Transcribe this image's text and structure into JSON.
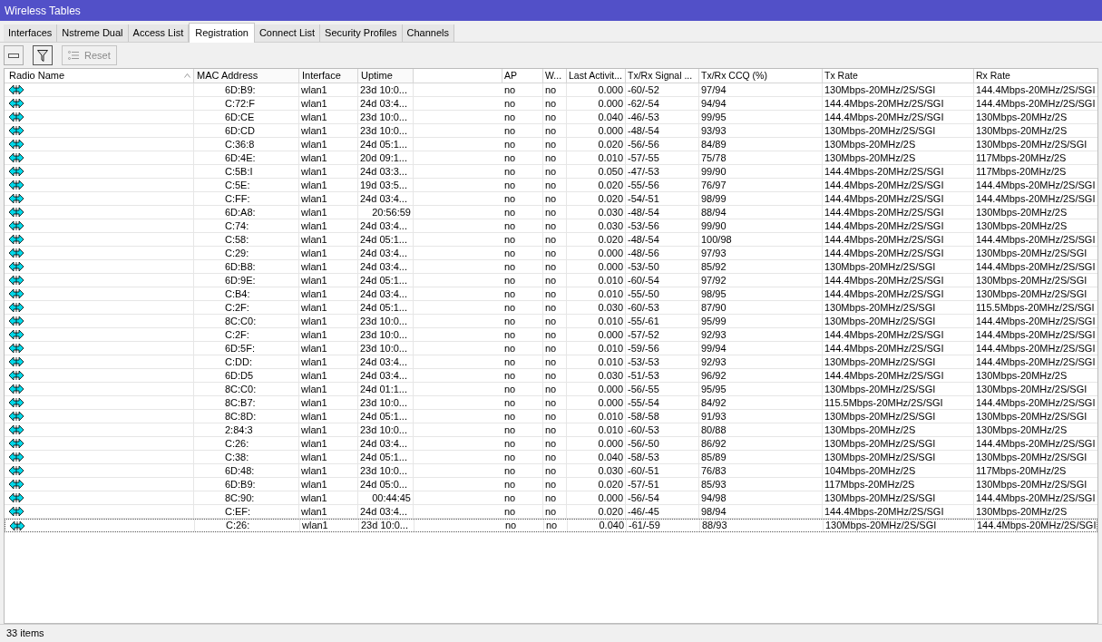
{
  "window": {
    "title": "Wireless Tables"
  },
  "tabs": [
    {
      "label": "Interfaces",
      "selected": false
    },
    {
      "label": "Nstreme Dual",
      "selected": false
    },
    {
      "label": "Access List",
      "selected": false
    },
    {
      "label": "Registration",
      "selected": true
    },
    {
      "label": "Connect List",
      "selected": false
    },
    {
      "label": "Security Profiles",
      "selected": false
    },
    {
      "label": "Channels",
      "selected": false
    }
  ],
  "toolbar": {
    "reset": {
      "label": "Reset",
      "disabled": true
    }
  },
  "table": {
    "columns": [
      {
        "label": "Radio Name",
        "sorted": true
      },
      {
        "label": "MAC Address",
        "sorted": false
      },
      {
        "label": "Interface",
        "sorted": false
      },
      {
        "label": "Uptime",
        "sorted": false
      },
      {
        "label": "AP",
        "sorted": false
      },
      {
        "label": "W...",
        "sorted": false
      },
      {
        "label": "Last Activit...",
        "sorted": false
      },
      {
        "label": "Tx/Rx Signal ...",
        "sorted": false
      },
      {
        "label": "Tx/Rx CCQ (%)",
        "sorted": false
      },
      {
        "label": "Tx Rate",
        "sorted": false
      },
      {
        "label": "Rx Rate",
        "sorted": false
      }
    ],
    "rows": [
      {
        "mac": "6D:B9:",
        "interface": "wlan1",
        "uptime": "23d 10:0...",
        "ap": "no",
        "w": "no",
        "last_activity": "0.000",
        "signal": "-60/-52",
        "ccq": "97/94",
        "tx_rate": "130Mbps-20MHz/2S/SGI",
        "rx_rate": "144.4Mbps-20MHz/2S/SGI",
        "focused": false
      },
      {
        "mac": "C:72:F",
        "interface": "wlan1",
        "uptime": "24d 03:4...",
        "ap": "no",
        "w": "no",
        "last_activity": "0.000",
        "signal": "-62/-54",
        "ccq": "94/94",
        "tx_rate": "144.4Mbps-20MHz/2S/SGI",
        "rx_rate": "144.4Mbps-20MHz/2S/SGI",
        "focused": false
      },
      {
        "mac": "6D:CE",
        "interface": "wlan1",
        "uptime": "23d 10:0...",
        "ap": "no",
        "w": "no",
        "last_activity": "0.040",
        "signal": "-46/-53",
        "ccq": "99/95",
        "tx_rate": "144.4Mbps-20MHz/2S/SGI",
        "rx_rate": "130Mbps-20MHz/2S",
        "focused": false
      },
      {
        "mac": "6D:CD",
        "interface": "wlan1",
        "uptime": "23d 10:0...",
        "ap": "no",
        "w": "no",
        "last_activity": "0.000",
        "signal": "-48/-54",
        "ccq": "93/93",
        "tx_rate": "130Mbps-20MHz/2S/SGI",
        "rx_rate": "130Mbps-20MHz/2S",
        "focused": false
      },
      {
        "mac": "C:36:8",
        "interface": "wlan1",
        "uptime": "24d 05:1...",
        "ap": "no",
        "w": "no",
        "last_activity": "0.020",
        "signal": "-56/-56",
        "ccq": "84/89",
        "tx_rate": "130Mbps-20MHz/2S",
        "rx_rate": "130Mbps-20MHz/2S/SGI",
        "focused": false
      },
      {
        "mac": "6D:4E:",
        "interface": "wlan1",
        "uptime": "20d 09:1...",
        "ap": "no",
        "w": "no",
        "last_activity": "0.010",
        "signal": "-57/-55",
        "ccq": "75/78",
        "tx_rate": "130Mbps-20MHz/2S",
        "rx_rate": "117Mbps-20MHz/2S",
        "focused": false
      },
      {
        "mac": "C:5B:I",
        "interface": "wlan1",
        "uptime": "24d 03:3...",
        "ap": "no",
        "w": "no",
        "last_activity": "0.050",
        "signal": "-47/-53",
        "ccq": "99/90",
        "tx_rate": "144.4Mbps-20MHz/2S/SGI",
        "rx_rate": "117Mbps-20MHz/2S",
        "focused": false
      },
      {
        "mac": "C:5E:",
        "interface": "wlan1",
        "uptime": "19d 03:5...",
        "ap": "no",
        "w": "no",
        "last_activity": "0.020",
        "signal": "-55/-56",
        "ccq": "76/97",
        "tx_rate": "144.4Mbps-20MHz/2S/SGI",
        "rx_rate": "144.4Mbps-20MHz/2S/SGI",
        "focused": false
      },
      {
        "mac": "C:FF:",
        "interface": "wlan1",
        "uptime": "24d 03:4...",
        "ap": "no",
        "w": "no",
        "last_activity": "0.020",
        "signal": "-54/-51",
        "ccq": "98/99",
        "tx_rate": "144.4Mbps-20MHz/2S/SGI",
        "rx_rate": "144.4Mbps-20MHz/2S/SGI",
        "focused": false
      },
      {
        "mac": "6D:A8:",
        "interface": "wlan1",
        "uptime": "20:56:59",
        "ap": "no",
        "w": "no",
        "last_activity": "0.030",
        "signal": "-48/-54",
        "ccq": "88/94",
        "tx_rate": "144.4Mbps-20MHz/2S/SGI",
        "rx_rate": "130Mbps-20MHz/2S",
        "focused": false
      },
      {
        "mac": "C:74:",
        "interface": "wlan1",
        "uptime": "24d 03:4...",
        "ap": "no",
        "w": "no",
        "last_activity": "0.030",
        "signal": "-53/-56",
        "ccq": "99/90",
        "tx_rate": "144.4Mbps-20MHz/2S/SGI",
        "rx_rate": "130Mbps-20MHz/2S",
        "focused": false
      },
      {
        "mac": "C:58:",
        "interface": "wlan1",
        "uptime": "24d 05:1...",
        "ap": "no",
        "w": "no",
        "last_activity": "0.020",
        "signal": "-48/-54",
        "ccq": "100/98",
        "tx_rate": "144.4Mbps-20MHz/2S/SGI",
        "rx_rate": "144.4Mbps-20MHz/2S/SGI",
        "focused": false
      },
      {
        "mac": "C:29:",
        "interface": "wlan1",
        "uptime": "24d 03:4...",
        "ap": "no",
        "w": "no",
        "last_activity": "0.000",
        "signal": "-48/-56",
        "ccq": "97/93",
        "tx_rate": "144.4Mbps-20MHz/2S/SGI",
        "rx_rate": "130Mbps-20MHz/2S/SGI",
        "focused": false
      },
      {
        "mac": "6D:B8:",
        "interface": "wlan1",
        "uptime": "24d 03:4...",
        "ap": "no",
        "w": "no",
        "last_activity": "0.000",
        "signal": "-53/-50",
        "ccq": "85/92",
        "tx_rate": "130Mbps-20MHz/2S/SGI",
        "rx_rate": "144.4Mbps-20MHz/2S/SGI",
        "focused": false
      },
      {
        "mac": "6D:9E:",
        "interface": "wlan1",
        "uptime": "24d 05:1...",
        "ap": "no",
        "w": "no",
        "last_activity": "0.010",
        "signal": "-60/-54",
        "ccq": "97/92",
        "tx_rate": "144.4Mbps-20MHz/2S/SGI",
        "rx_rate": "130Mbps-20MHz/2S/SGI",
        "focused": false
      },
      {
        "mac": "C:B4:",
        "interface": "wlan1",
        "uptime": "24d 03:4...",
        "ap": "no",
        "w": "no",
        "last_activity": "0.010",
        "signal": "-55/-50",
        "ccq": "98/95",
        "tx_rate": "144.4Mbps-20MHz/2S/SGI",
        "rx_rate": "130Mbps-20MHz/2S/SGI",
        "focused": false
      },
      {
        "mac": "C:2F:",
        "interface": "wlan1",
        "uptime": "24d 05:1...",
        "ap": "no",
        "w": "no",
        "last_activity": "0.030",
        "signal": "-60/-53",
        "ccq": "87/90",
        "tx_rate": "130Mbps-20MHz/2S/SGI",
        "rx_rate": "115.5Mbps-20MHz/2S/SGI",
        "focused": false
      },
      {
        "mac": "8C:C0:",
        "interface": "wlan1",
        "uptime": "23d 10:0...",
        "ap": "no",
        "w": "no",
        "last_activity": "0.010",
        "signal": "-55/-61",
        "ccq": "95/99",
        "tx_rate": "130Mbps-20MHz/2S/SGI",
        "rx_rate": "144.4Mbps-20MHz/2S/SGI",
        "focused": false
      },
      {
        "mac": "C:2F:",
        "interface": "wlan1",
        "uptime": "23d 10:0...",
        "ap": "no",
        "w": "no",
        "last_activity": "0.000",
        "signal": "-57/-52",
        "ccq": "92/93",
        "tx_rate": "144.4Mbps-20MHz/2S/SGI",
        "rx_rate": "144.4Mbps-20MHz/2S/SGI",
        "focused": false
      },
      {
        "mac": "6D:5F:",
        "interface": "wlan1",
        "uptime": "23d 10:0...",
        "ap": "no",
        "w": "no",
        "last_activity": "0.010",
        "signal": "-59/-56",
        "ccq": "99/94",
        "tx_rate": "144.4Mbps-20MHz/2S/SGI",
        "rx_rate": "144.4Mbps-20MHz/2S/SGI",
        "focused": false
      },
      {
        "mac": "C:DD:",
        "interface": "wlan1",
        "uptime": "24d 03:4...",
        "ap": "no",
        "w": "no",
        "last_activity": "0.010",
        "signal": "-53/-53",
        "ccq": "92/93",
        "tx_rate": "130Mbps-20MHz/2S/SGI",
        "rx_rate": "144.4Mbps-20MHz/2S/SGI",
        "focused": false
      },
      {
        "mac": "6D:D5",
        "interface": "wlan1",
        "uptime": "24d 03:4...",
        "ap": "no",
        "w": "no",
        "last_activity": "0.030",
        "signal": "-51/-53",
        "ccq": "96/92",
        "tx_rate": "144.4Mbps-20MHz/2S/SGI",
        "rx_rate": "130Mbps-20MHz/2S",
        "focused": false
      },
      {
        "mac": "8C:C0:",
        "interface": "wlan1",
        "uptime": "24d 01:1...",
        "ap": "no",
        "w": "no",
        "last_activity": "0.000",
        "signal": "-56/-55",
        "ccq": "95/95",
        "tx_rate": "130Mbps-20MHz/2S/SGI",
        "rx_rate": "130Mbps-20MHz/2S/SGI",
        "focused": false
      },
      {
        "mac": "8C:B7:",
        "interface": "wlan1",
        "uptime": "23d 10:0...",
        "ap": "no",
        "w": "no",
        "last_activity": "0.000",
        "signal": "-55/-54",
        "ccq": "84/92",
        "tx_rate": "115.5Mbps-20MHz/2S/SGI",
        "rx_rate": "144.4Mbps-20MHz/2S/SGI",
        "focused": false
      },
      {
        "mac": "8C:8D:",
        "interface": "wlan1",
        "uptime": "24d 05:1...",
        "ap": "no",
        "w": "no",
        "last_activity": "0.010",
        "signal": "-58/-58",
        "ccq": "91/93",
        "tx_rate": "130Mbps-20MHz/2S/SGI",
        "rx_rate": "130Mbps-20MHz/2S/SGI",
        "focused": false
      },
      {
        "mac": "2:84:3",
        "interface": "wlan1",
        "uptime": "23d 10:0...",
        "ap": "no",
        "w": "no",
        "last_activity": "0.010",
        "signal": "-60/-53",
        "ccq": "80/88",
        "tx_rate": "130Mbps-20MHz/2S",
        "rx_rate": "130Mbps-20MHz/2S",
        "focused": false
      },
      {
        "mac": "C:26:",
        "interface": "wlan1",
        "uptime": "24d 03:4...",
        "ap": "no",
        "w": "no",
        "last_activity": "0.000",
        "signal": "-56/-50",
        "ccq": "86/92",
        "tx_rate": "130Mbps-20MHz/2S/SGI",
        "rx_rate": "144.4Mbps-20MHz/2S/SGI",
        "focused": false
      },
      {
        "mac": "C:38:",
        "interface": "wlan1",
        "uptime": "24d 05:1...",
        "ap": "no",
        "w": "no",
        "last_activity": "0.040",
        "signal": "-58/-53",
        "ccq": "85/89",
        "tx_rate": "130Mbps-20MHz/2S/SGI",
        "rx_rate": "130Mbps-20MHz/2S/SGI",
        "focused": false
      },
      {
        "mac": "6D:48:",
        "interface": "wlan1",
        "uptime": "23d 10:0...",
        "ap": "no",
        "w": "no",
        "last_activity": "0.030",
        "signal": "-60/-51",
        "ccq": "76/83",
        "tx_rate": "104Mbps-20MHz/2S",
        "rx_rate": "117Mbps-20MHz/2S",
        "focused": false
      },
      {
        "mac": "6D:B9:",
        "interface": "wlan1",
        "uptime": "24d 05:0...",
        "ap": "no",
        "w": "no",
        "last_activity": "0.020",
        "signal": "-57/-51",
        "ccq": "85/93",
        "tx_rate": "117Mbps-20MHz/2S",
        "rx_rate": "130Mbps-20MHz/2S/SGI",
        "focused": false
      },
      {
        "mac": "8C:90:",
        "interface": "wlan1",
        "uptime": "00:44:45",
        "ap": "no",
        "w": "no",
        "last_activity": "0.000",
        "signal": "-56/-54",
        "ccq": "94/98",
        "tx_rate": "130Mbps-20MHz/2S/SGI",
        "rx_rate": "144.4Mbps-20MHz/2S/SGI",
        "focused": false
      },
      {
        "mac": "C:EF:",
        "interface": "wlan1",
        "uptime": "24d 03:4...",
        "ap": "no",
        "w": "no",
        "last_activity": "0.020",
        "signal": "-46/-45",
        "ccq": "98/94",
        "tx_rate": "144.4Mbps-20MHz/2S/SGI",
        "rx_rate": "130Mbps-20MHz/2S",
        "focused": false
      },
      {
        "mac": "C:26:",
        "interface": "wlan1",
        "uptime": "23d 10:0...",
        "ap": "no",
        "w": "no",
        "last_activity": "0.040",
        "signal": "-61/-59",
        "ccq": "88/93",
        "tx_rate": "130Mbps-20MHz/2S/SGI",
        "rx_rate": "144.4Mbps-20MHz/2S/SGI",
        "focused": true
      }
    ]
  },
  "status_bar": {
    "text": "33 items"
  }
}
